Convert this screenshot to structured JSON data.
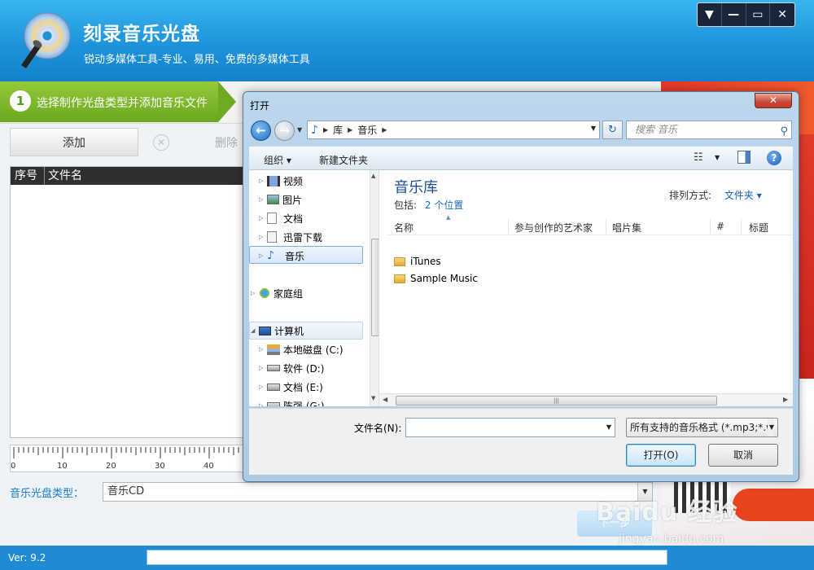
{
  "app": {
    "title": "刻录音乐光盘",
    "subtitle": "锐动多媒体工具-专业、易用、免费的多媒体工具",
    "window_controls": [
      "▼",
      "—",
      "▭",
      "✕"
    ]
  },
  "steps": {
    "current_num": "1",
    "current_label": "选择制作光盘类型并添加音乐文件"
  },
  "toolbar": {
    "add_label": "添加",
    "delete_label": "删除"
  },
  "file_list": {
    "columns": [
      "序号",
      "文件名"
    ]
  },
  "ruler": {
    "labels": [
      "0",
      "10",
      "20",
      "30",
      "40"
    ]
  },
  "disc_type": {
    "label": "音乐光盘类型：",
    "value": "音乐CD"
  },
  "next_button": "下一步",
  "status": {
    "version": "Ver: 9.2"
  },
  "dialog": {
    "title": "打开",
    "close_label": "✕",
    "address": {
      "crumbs": [
        "库",
        "音乐"
      ]
    },
    "search_placeholder": "搜索 音乐",
    "commands": {
      "organize": "组织 ▾",
      "new_folder": "新建文件夹"
    },
    "nav": {
      "items": [
        {
          "label": "视频",
          "icon": "video-icon"
        },
        {
          "label": "图片",
          "icon": "picture-icon"
        },
        {
          "label": "文档",
          "icon": "document-icon"
        },
        {
          "label": "迅雷下载",
          "icon": "download-icon"
        },
        {
          "label": "音乐",
          "icon": "music-icon"
        },
        {
          "label": "家庭组",
          "icon": "homegroup-icon"
        },
        {
          "label": "计算机",
          "icon": "computer-icon"
        },
        {
          "label": "本地磁盘 (C:)",
          "icon": "drive-icon"
        },
        {
          "label": "软件 (D:)",
          "icon": "drive-icon"
        },
        {
          "label": "文档 (E:)",
          "icon": "drive-icon"
        },
        {
          "label": "陈强 (G:)",
          "icon": "drive-icon"
        }
      ]
    },
    "library": {
      "title": "音乐库",
      "includes_label": "包括:",
      "includes_link": "2 个位置",
      "sort_label": "排列方式:",
      "sort_value": "文件夹 ▾"
    },
    "columns": [
      "名称",
      "参与创作的艺术家",
      "唱片集",
      "#",
      "标题"
    ],
    "files": [
      "iTunes",
      "Sample Music"
    ],
    "filename_label": "文件名(N):",
    "filename_value": "",
    "filter_value": "所有支持的音乐格式 (*.mp3;*.w",
    "open_label": "打开(O)",
    "cancel_label": "取消"
  },
  "watermark": {
    "main": "Baidu 经验",
    "sub": "jingyan.baidu.com"
  }
}
